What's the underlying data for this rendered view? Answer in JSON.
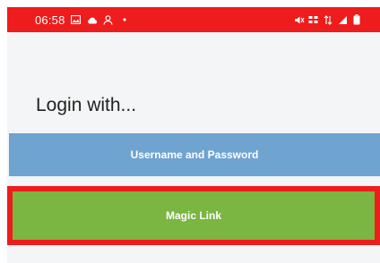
{
  "status_bar": {
    "time": "06:58",
    "bg_color": "#ee1c1c",
    "left_icons": [
      "gallery-icon",
      "cloud-icon",
      "person-icon",
      "dot-icon"
    ],
    "right_icons": [
      "mute-icon",
      "volte-icon",
      "data-icon",
      "signal-icon",
      "battery-icon"
    ]
  },
  "login": {
    "heading": "Login with...",
    "username_password_label": "Username and Password",
    "magic_link_label": "Magic Link"
  },
  "colors": {
    "username_password_button": "#6fa3d0",
    "magic_link_button": "#7bb542",
    "highlight": "#ee1c1c",
    "background": "#f4f5f6"
  }
}
